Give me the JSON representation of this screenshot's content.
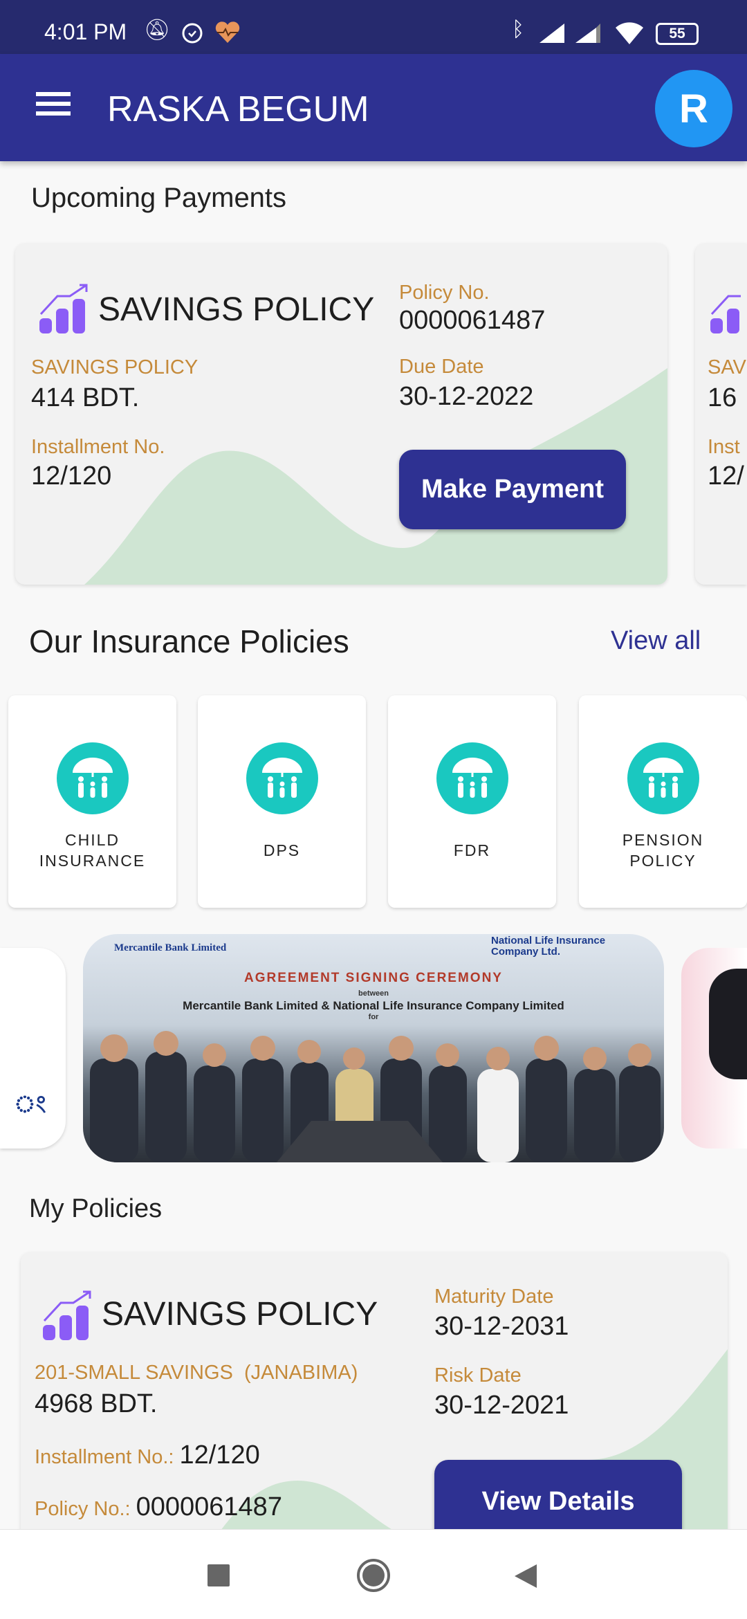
{
  "status_bar": {
    "time": "4:01 PM",
    "battery": "55",
    "icons": [
      "mute-icon",
      "alarm-icon",
      "health-icon",
      "bluetooth-icon",
      "signal-icon",
      "signal-icon",
      "wifi-icon",
      "battery-icon"
    ]
  },
  "app_bar": {
    "title": "RASKA BEGUM",
    "avatar_letter": "R",
    "menu_icon": "hamburger-icon"
  },
  "colors": {
    "primary": "#2e3192",
    "status": "#262a6e",
    "avatar": "#2196f3",
    "label": "#c58a3a",
    "teal": "#1ac8c0",
    "wave": "#cfe5d3"
  },
  "upcoming": {
    "title": "Upcoming Payments",
    "cards": [
      {
        "policy_title": "SAVINGS POLICY",
        "type_label": "SAVINGS POLICY",
        "amount": "414 BDT.",
        "installment_label": "Installment No.",
        "installment": "12/120",
        "policy_no_label": "Policy No.",
        "policy_no": "0000061487",
        "due_label": "Due Date",
        "due_date": "30-12-2022",
        "button": "Make Payment"
      },
      {
        "type_label": "SAV",
        "amount": "16",
        "installment_label": "Inst",
        "installment": "12/"
      }
    ]
  },
  "policies": {
    "title": "Our Insurance Policies",
    "view_all": "View all",
    "items": [
      {
        "label": "CHILD\nINSURANCE"
      },
      {
        "label": "DPS"
      },
      {
        "label": "FDR"
      },
      {
        "label": "PENSION\nPOLICY"
      }
    ]
  },
  "banner": {
    "heading": "AGREEMENT SIGNING CEREMONY",
    "between": "between",
    "parties": "Mercantile Bank Limited & National Life Insurance Company Limited",
    "for": "for",
    "left_logo": "Mercantile Bank Limited",
    "right_logo": "National Life Insurance Company Ltd."
  },
  "my_policies": {
    "title": "My Policies",
    "card": {
      "policy_title": "SAVINGS POLICY",
      "plan": "201-SMALL SAVINGS  (JANABIMA)",
      "amount": "4968 BDT.",
      "installment_label": "Installment No.:",
      "installment": "12/120",
      "policy_no_label": "Policy No.:",
      "policy_no": "0000061487",
      "maturity_label": "Maturity Date",
      "maturity_date": "30-12-2031",
      "risk_label": "Risk Date",
      "risk_date": "30-12-2021",
      "button": "View Details"
    }
  }
}
